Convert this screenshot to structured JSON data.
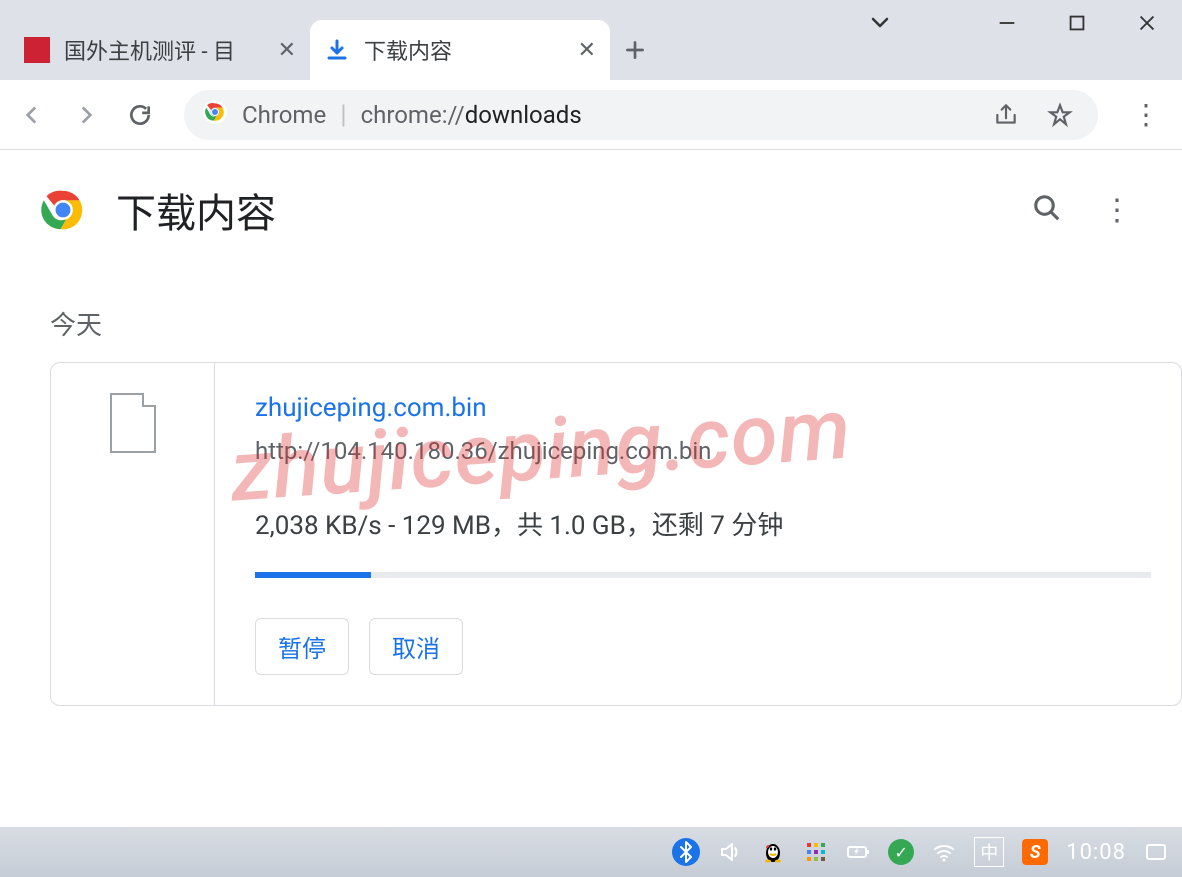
{
  "window": {
    "tabs": [
      {
        "label": "国外主机测评 - 目",
        "active": false
      },
      {
        "label": "下载内容",
        "active": true
      }
    ],
    "new_tab_label": "+"
  },
  "toolbar": {
    "omnibox_app": "Chrome",
    "omnibox_sep": "|",
    "omnibox_prefix": "chrome://",
    "omnibox_path": "downloads"
  },
  "page": {
    "title": "下载内容",
    "section_today": "今天"
  },
  "download": {
    "filename": "zhujiceping.com.bin",
    "url": "http://104.140.180.36/zhujiceping.com.bin",
    "status": "2,038 KB/s - 129 MB，共 1.0 GB，还剩 7 分钟",
    "progress_percent": 13,
    "pause_label": "暂停",
    "cancel_label": "取消"
  },
  "watermark": "zhujiceping.com",
  "taskbar": {
    "ime": "中",
    "sogou": "S",
    "clock": "10:08"
  }
}
